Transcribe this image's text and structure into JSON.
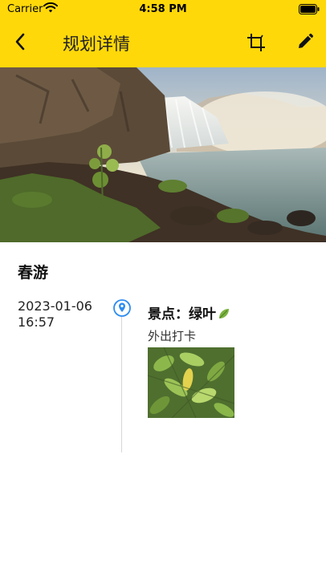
{
  "status_bar": {
    "carrier": "Carrier",
    "time": "4:58 PM"
  },
  "nav": {
    "title": "规划详情",
    "icons": [
      "chevron-left-icon",
      "crop-icon",
      "pencil-icon"
    ]
  },
  "colors": {
    "nav_background": "#ffd80a",
    "timeline_accent": "#2d8cf0"
  },
  "plan": {
    "title": "春游",
    "entries": [
      {
        "date": "2023-01-06",
        "time": "16:57",
        "spot_label": "景点：绿叶",
        "description": "外出打卡"
      }
    ]
  }
}
